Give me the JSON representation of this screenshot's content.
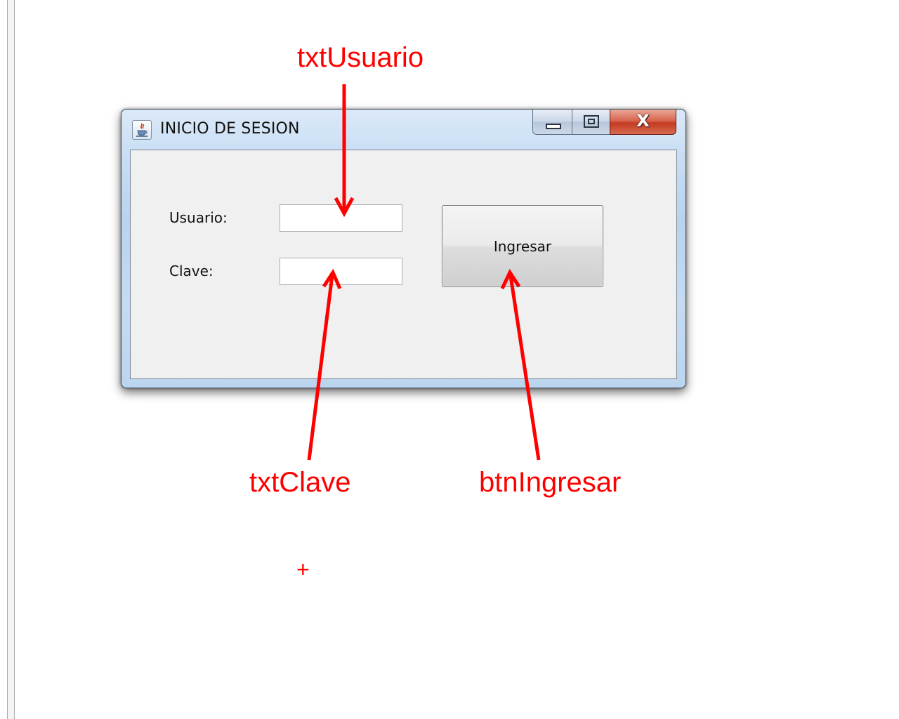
{
  "window": {
    "title": "INICIO DE SESION",
    "icon": "java-cup-icon",
    "close_glyph": "X"
  },
  "form": {
    "usuario_label": "Usuario:",
    "usuario_value": "",
    "clave_label": "Clave:",
    "clave_value": "",
    "ingresar_label": "Ingresar"
  },
  "annotations": {
    "txt_usuario": "txtUsuario",
    "txt_clave": "txtClave",
    "btn_ingresar": "btnIngresar",
    "color": "#ff0000"
  },
  "cursor": {
    "glyph": "+",
    "icon": "crosshair-cursor-icon"
  }
}
